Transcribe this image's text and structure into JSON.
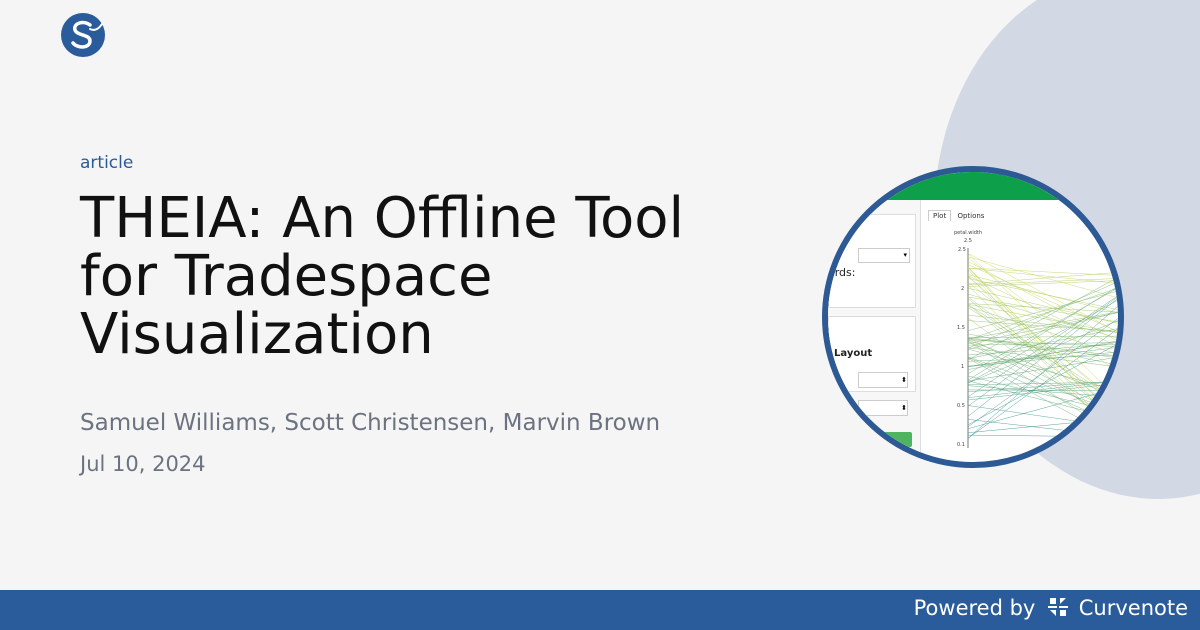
{
  "header": {
    "logo_icon": "scipy-logo-icon"
  },
  "article": {
    "kind": "article",
    "title": "THEIA: An Offline Tool for Tradespace Visualization",
    "authors": "Samuel Williams, Scott Christensen, Marvin Brown",
    "date": "Jul 10, 2024"
  },
  "thumbnail": {
    "tabs": [
      "Plot",
      "Options"
    ],
    "select_arrow": "▾",
    "words_label": "ords:",
    "layout_label": "Layout",
    "spinner_arrows": "⬍",
    "axis_title": "petal.width",
    "axis_top": "2.5",
    "ticks": [
      "2.5",
      "2",
      "1.5",
      "1",
      "0.5",
      "0.1"
    ]
  },
  "footer": {
    "powered_label": "Powered by",
    "brand": "Curvenote"
  },
  "colors": {
    "accent": "#2c5a97",
    "footer_bg": "#2a5c9b",
    "blob": "#d3d9e4",
    "topbar": "#0d9f49"
  }
}
